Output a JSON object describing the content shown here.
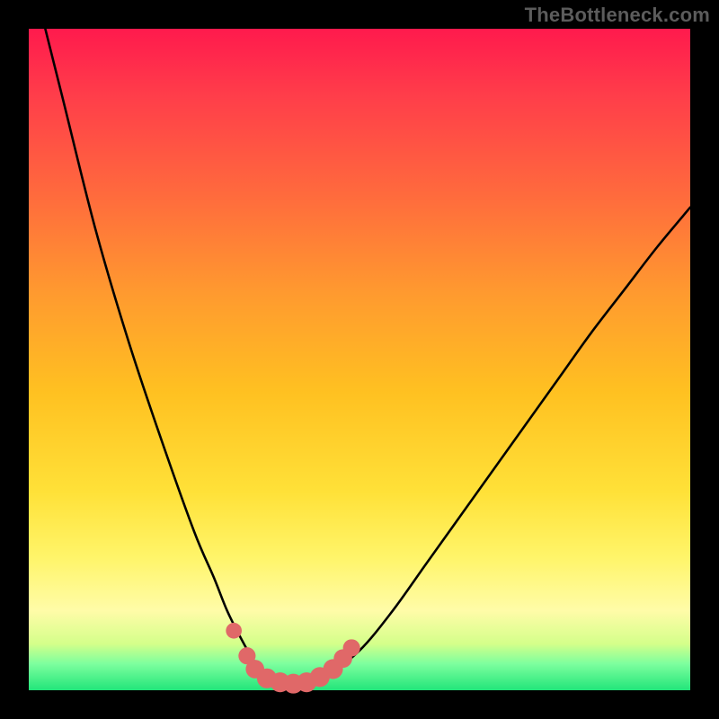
{
  "watermark": "TheBottleneck.com",
  "colors": {
    "page_bg": "#000000",
    "curve": "#000000",
    "dot_fill": "#e06868",
    "watermark_text": "#5c5c5c"
  },
  "chart_data": {
    "type": "line",
    "title": "",
    "xlabel": "",
    "ylabel": "",
    "xlim": [
      0,
      100
    ],
    "ylim": [
      0,
      100
    ],
    "grid": false,
    "series": [
      {
        "name": "bottleneck-curve",
        "x": [
          0,
          5,
          10,
          15,
          20,
          25,
          28,
          30,
          32,
          34,
          36,
          38,
          40,
          42,
          45,
          50,
          55,
          60,
          65,
          70,
          75,
          80,
          85,
          90,
          95,
          100
        ],
        "values": [
          110,
          90,
          70,
          53,
          38,
          24,
          17,
          12,
          8,
          4.5,
          2.2,
          1.2,
          1.0,
          1.2,
          2.2,
          6,
          12,
          19,
          26,
          33,
          40,
          47,
          54,
          60.5,
          67,
          73
        ]
      }
    ],
    "markers": [
      {
        "name": "dot-1",
        "x": 31.0,
        "y": 9.0,
        "r": 1.2
      },
      {
        "name": "dot-2",
        "x": 33.0,
        "y": 5.2,
        "r": 1.3
      },
      {
        "name": "dot-3",
        "x": 34.2,
        "y": 3.2,
        "r": 1.4
      },
      {
        "name": "dot-4",
        "x": 36.0,
        "y": 1.8,
        "r": 1.5
      },
      {
        "name": "dot-5",
        "x": 38.0,
        "y": 1.2,
        "r": 1.5
      },
      {
        "name": "dot-6",
        "x": 40.0,
        "y": 1.0,
        "r": 1.5
      },
      {
        "name": "dot-7",
        "x": 42.0,
        "y": 1.2,
        "r": 1.5
      },
      {
        "name": "dot-8",
        "x": 44.0,
        "y": 2.0,
        "r": 1.5
      },
      {
        "name": "dot-9",
        "x": 46.0,
        "y": 3.2,
        "r": 1.5
      },
      {
        "name": "dot-10",
        "x": 47.5,
        "y": 4.8,
        "r": 1.4
      },
      {
        "name": "dot-11",
        "x": 48.8,
        "y": 6.4,
        "r": 1.3
      }
    ]
  }
}
